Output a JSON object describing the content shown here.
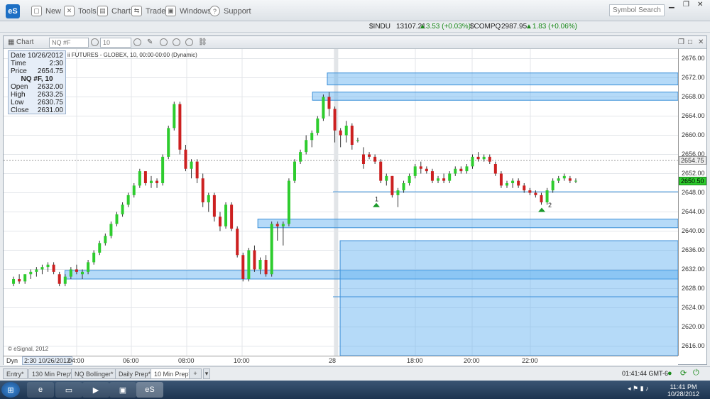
{
  "app": {
    "logo": "eS",
    "menu": [
      {
        "label": "New",
        "icon": "document-icon"
      },
      {
        "label": "Tools",
        "icon": "tools-icon"
      },
      {
        "label": "Chart",
        "icon": "chart-icon"
      },
      {
        "label": "Trade",
        "icon": "trade-icon"
      },
      {
        "label": "Windows",
        "icon": "windows-icon"
      },
      {
        "label": "Support",
        "icon": "help-icon"
      }
    ],
    "search_placeholder": "Symbol Search"
  },
  "ticker": {
    "indu_sym": "$INDU",
    "indu_val": "13107.21",
    "indu_chg": "▲3.53 (+0.03%)",
    "compq_sym": "$COMPQ",
    "compq_val": "2987.95",
    "compq_chg": "▲1.83 (+0.06%)"
  },
  "chart": {
    "label": "Chart",
    "symbol": "NQ #F",
    "interval": "10",
    "subtitle": "ii FUTURES - GLOBEX, 10, 00:00-00:00 (Dynamic)",
    "copyright": "© eSignal, 2012"
  },
  "databox": {
    "date_label": "Date",
    "date": "10/26/2012",
    "time_label": "Time",
    "time": "2:30",
    "price_label": "Price",
    "price": "2654.75",
    "sym": "NQ #F, 10",
    "open_label": "Open",
    "open": "2632.00",
    "high_label": "High",
    "high": "2633.25",
    "low_label": "Low",
    "low": "2630.75",
    "close_label": "Close",
    "close": "2631.00"
  },
  "xaxis": {
    "dyn": "Dyn",
    "cursor": "2:30 10/26/2012",
    "labels": [
      "04:00",
      "06:00",
      "08:00",
      "10:00",
      "28",
      "18:00",
      "20:00",
      "22:00"
    ]
  },
  "yaxis": {
    "labels": [
      "2676.00",
      "2672.00",
      "2668.00",
      "2664.00",
      "2660.00",
      "2656.00",
      "2652.00",
      "2648.00",
      "2644.00",
      "2640.00",
      "2636.00",
      "2632.00",
      "2628.00",
      "2624.00",
      "2620.00",
      "2616.00"
    ],
    "cursor_price": "2654.75",
    "last_price": "2650.50"
  },
  "markers": {
    "m1": "1",
    "m2": "2"
  },
  "tabs": [
    "Entry*",
    "130 Min Prep*",
    "NQ Bollinger*",
    "Daily Prep*",
    "10 Min Prep*"
  ],
  "status": {
    "time": "01:41:44 GMT-6"
  },
  "clock": {
    "time": "11:41 PM",
    "date": "10/28/2012"
  },
  "colors": {
    "up": "#2ecc2e",
    "down": "#cc2020",
    "zone": "#5aaef0"
  },
  "chart_data": {
    "type": "candlestick",
    "ylim": [
      2614,
      2678
    ],
    "candles": [
      [
        2629,
        2630.5,
        2628.5,
        2630
      ],
      [
        2630,
        2631,
        2629,
        2629.5
      ],
      [
        2629.5,
        2631,
        2629,
        2631
      ],
      [
        2631,
        2632,
        2630,
        2631.5
      ],
      [
        2631.5,
        2632.5,
        2630.5,
        2632
      ],
      [
        2632,
        2633,
        2631,
        2632.5
      ],
      [
        2632.5,
        2633.5,
        2631.5,
        2633
      ],
      [
        2633,
        2633.5,
        2631,
        2631.5
      ],
      [
        2631,
        2631.5,
        2628.5,
        2629
      ],
      [
        2629,
        2631,
        2628.5,
        2630.5
      ],
      [
        2630.5,
        2632.5,
        2630,
        2632
      ],
      [
        2632,
        2633,
        2631,
        2631.5
      ],
      [
        2631,
        2632,
        2630,
        2631.5
      ],
      [
        2631.5,
        2634,
        2631,
        2633.5
      ],
      [
        2633.5,
        2636,
        2633,
        2635.5
      ],
      [
        2635.5,
        2638,
        2635,
        2637.5
      ],
      [
        2637.5,
        2639.5,
        2637,
        2639
      ],
      [
        2639,
        2642,
        2638.5,
        2641.5
      ],
      [
        2641.5,
        2644,
        2641,
        2643.5
      ],
      [
        2643.5,
        2646,
        2643,
        2645.5
      ],
      [
        2645.5,
        2648,
        2645,
        2647.5
      ],
      [
        2647.5,
        2650,
        2647,
        2649.5
      ],
      [
        2649.5,
        2653,
        2649,
        2652.5
      ],
      [
        2652.5,
        2652.5,
        2649.5,
        2650
      ],
      [
        2650,
        2651.5,
        2649,
        2650.5
      ],
      [
        2650.5,
        2651,
        2649,
        2650
      ],
      [
        2650,
        2656,
        2649.5,
        2655.5
      ],
      [
        2655.5,
        2662,
        2655,
        2661.5
      ],
      [
        2661.5,
        2667,
        2661,
        2666.5
      ],
      [
        2666.5,
        2667,
        2656,
        2657
      ],
      [
        2657,
        2658,
        2652.5,
        2653
      ],
      [
        2653,
        2655,
        2651,
        2654.5
      ],
      [
        2654.5,
        2655,
        2650,
        2651
      ],
      [
        2651,
        2652,
        2645,
        2646
      ],
      [
        2646,
        2648,
        2644,
        2647.5
      ],
      [
        2647.5,
        2648,
        2642,
        2643
      ],
      [
        2643,
        2644,
        2640,
        2641
      ],
      [
        2641,
        2646,
        2640.5,
        2645.5
      ],
      [
        2645.5,
        2646,
        2640,
        2640.5
      ],
      [
        2640.5,
        2641,
        2634.5,
        2635
      ],
      [
        2635,
        2635.5,
        2629.5,
        2630
      ],
      [
        2630,
        2636.5,
        2629.5,
        2636
      ],
      [
        2636,
        2637,
        2631.5,
        2632
      ],
      [
        2632,
        2634.5,
        2631,
        2634
      ],
      [
        2634,
        2635,
        2630.5,
        2631
      ],
      [
        2631,
        2642,
        2630.5,
        2641.5
      ],
      [
        2641.5,
        2642,
        2638,
        2641
      ],
      [
        2641,
        2642,
        2637,
        2641.5
      ],
      [
        2641.5,
        2651,
        2641,
        2650.5
      ],
      [
        2650.5,
        2655,
        2650,
        2654.5
      ],
      [
        2654.5,
        2657,
        2654,
        2656.5
      ],
      [
        2656.5,
        2660,
        2656,
        2659
      ],
      [
        2659,
        2661,
        2657.5,
        2660.5
      ],
      [
        2660.5,
        2664,
        2660,
        2663.5
      ],
      [
        2663.5,
        2668.5,
        2663,
        2668
      ],
      [
        2668,
        2669,
        2664,
        2665.5
      ],
      [
        2665.5,
        2666,
        2658.5,
        2661
      ],
      [
        2661,
        2661.5,
        2657.5,
        2660
      ],
      [
        2660,
        2663,
        2658.5,
        2662
      ],
      [
        2662,
        2662.5,
        2657,
        2658
      ],
      [
        2659,
        2659.5,
        2658.5,
        2659
      ],
      [
        2656,
        2657.5,
        2653,
        2654
      ],
      [
        2656,
        2656.5,
        2655,
        2655.5
      ],
      [
        2655.5,
        2656,
        2654,
        2654.5
      ],
      [
        2654.5,
        2655,
        2650,
        2650.5
      ],
      [
        2650.5,
        2652,
        2649.5,
        2651.5
      ],
      [
        2651.5,
        2651.5,
        2647,
        2647.5
      ],
      [
        2647.5,
        2649,
        2645,
        2648.5
      ],
      [
        2648.5,
        2650.5,
        2648,
        2650
      ],
      [
        2650,
        2652,
        2649.5,
        2651.5
      ],
      [
        2651.5,
        2654,
        2651,
        2653.5
      ],
      [
        2653.5,
        2654.5,
        2652,
        2653
      ],
      [
        2653,
        2653.5,
        2652,
        2652.5
      ],
      [
        2652.5,
        2653,
        2650,
        2650.5
      ],
      [
        2650.5,
        2651.5,
        2650,
        2651
      ],
      [
        2651,
        2652,
        2650,
        2650.5
      ],
      [
        2650.5,
        2652.5,
        2650,
        2652
      ],
      [
        2652,
        2653.5,
        2651.5,
        2653
      ],
      [
        2653,
        2653.5,
        2652,
        2652.5
      ],
      [
        2652.5,
        2654,
        2652,
        2653.5
      ],
      [
        2653.5,
        2656,
        2653,
        2655.5
      ],
      [
        2655.5,
        2656.5,
        2654.5,
        2655
      ],
      [
        2655,
        2656,
        2654.5,
        2655.5
      ],
      [
        2655.5,
        2656,
        2654,
        2654.5
      ],
      [
        2654,
        2654.5,
        2651.5,
        2652
      ],
      [
        2652,
        2652.5,
        2649,
        2649.5
      ],
      [
        2649.5,
        2650.5,
        2649,
        2650
      ],
      [
        2650,
        2651,
        2649,
        2650.5
      ],
      [
        2650.5,
        2651,
        2649,
        2649.5
      ],
      [
        2649.5,
        2650,
        2648,
        2648.5
      ],
      [
        2648.5,
        2649,
        2647.5,
        2648
      ],
      [
        2648,
        2648.5,
        2647,
        2647.5
      ],
      [
        2647.5,
        2648,
        2645.5,
        2646
      ],
      [
        2646,
        2649,
        2645.5,
        2648.5
      ],
      [
        2648.5,
        2651,
        2648,
        2650.5
      ],
      [
        2650.5,
        2651.5,
        2650,
        2651
      ],
      [
        2651,
        2652,
        2650.5,
        2651.5
      ],
      [
        2651,
        2651.5,
        2650,
        2650.5
      ],
      [
        2650.5,
        2651,
        2650,
        2650.5
      ]
    ],
    "zones": [
      {
        "x0": 0.48,
        "x1": 1,
        "top": 2673,
        "bottom": 2670.5
      },
      {
        "x0": 0.458,
        "x1": 1,
        "top": 2669,
        "bottom": 2667.3
      },
      {
        "x0": 0.377,
        "x1": 1,
        "top": 2642.5,
        "bottom": 2640.7
      },
      {
        "x0": 0.091,
        "x1": 1,
        "top": 2631.8,
        "bottom": 2630
      },
      {
        "x0": 0.499,
        "x1": 1,
        "top": 2638,
        "bottom": 2614
      }
    ],
    "hlines": [
      2648.2,
      2626.3
    ],
    "separator_x": 0.493
  }
}
